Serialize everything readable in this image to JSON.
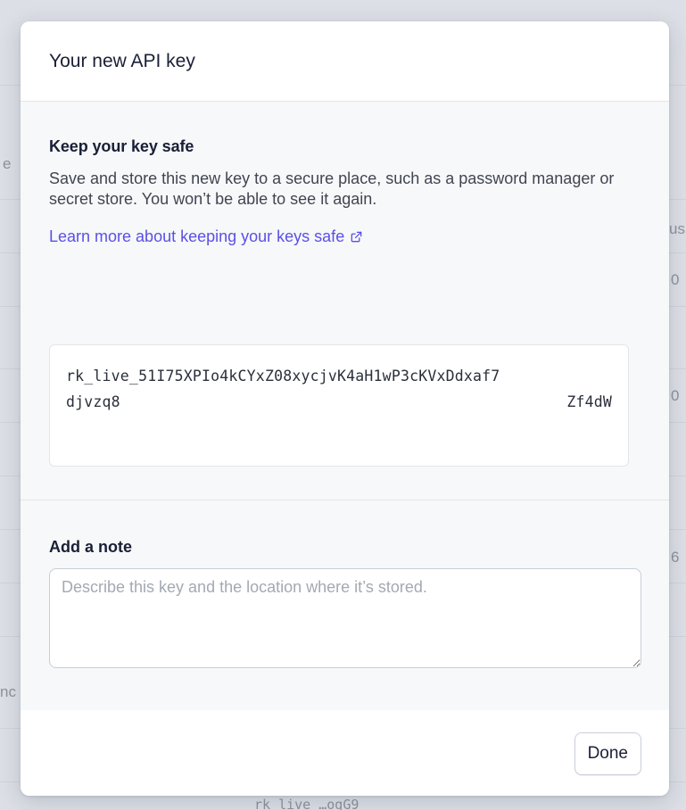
{
  "background": {
    "fragments": [
      "e",
      "us",
      "0",
      "0",
      "6",
      "nc",
      "rk_live_…ogG9"
    ]
  },
  "modal": {
    "title": "Your new API key",
    "safe_section": {
      "heading": "Keep your key safe",
      "body": "Save and store this new key to a secure place, such as a password manager or secret store. You won’t be able to see it again.",
      "link_label": "Learn more about keeping your keys safe",
      "link_icon": "external-link-icon"
    },
    "key": {
      "line1": "rk_live_51I75XPIo4kCYxZ08xycjvK4aH1wP3cKVxDdxaf7",
      "line2_start": "djvzq8",
      "line2_end": "Zf4dW"
    },
    "note_section": {
      "label": "Add a note",
      "placeholder": "Describe this key and the location where it’s stored.",
      "value": ""
    },
    "footer": {
      "done_label": "Done"
    }
  },
  "colors": {
    "link": "#5a50e6",
    "text": "#1a1f36",
    "muted": "#414552",
    "border": "#e3e6ea"
  }
}
